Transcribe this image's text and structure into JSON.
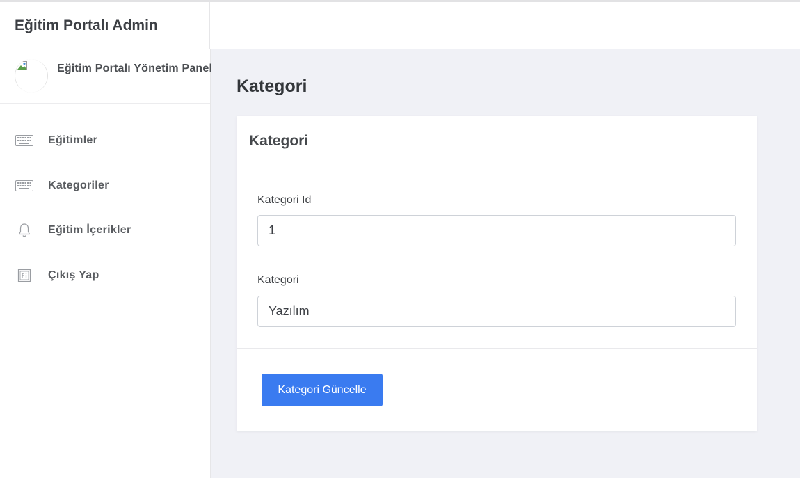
{
  "app": {
    "brand": "Eğitim Portalı Admin"
  },
  "profile": {
    "name": "Eğitim Portalı Yönetim Paneli"
  },
  "sidebar": {
    "items": [
      {
        "label": "Eğitimler",
        "icon": "keyboard-icon"
      },
      {
        "label": "Kategoriler",
        "icon": "keyboard-icon"
      },
      {
        "label": "Eğitim İçerikler",
        "icon": "bell-icon"
      },
      {
        "label": "Çıkış Yap",
        "icon": "logout-icon"
      }
    ]
  },
  "main": {
    "page_title": "Kategori",
    "card": {
      "title": "Kategori",
      "fields": [
        {
          "label": "Kategori Id",
          "value": "1"
        },
        {
          "label": "Kategori",
          "value": "Yazılım"
        }
      ],
      "submit_label": "Kategori Güncelle"
    }
  },
  "colors": {
    "accent": "#3a7bf0",
    "background": "#f0f1f6"
  }
}
